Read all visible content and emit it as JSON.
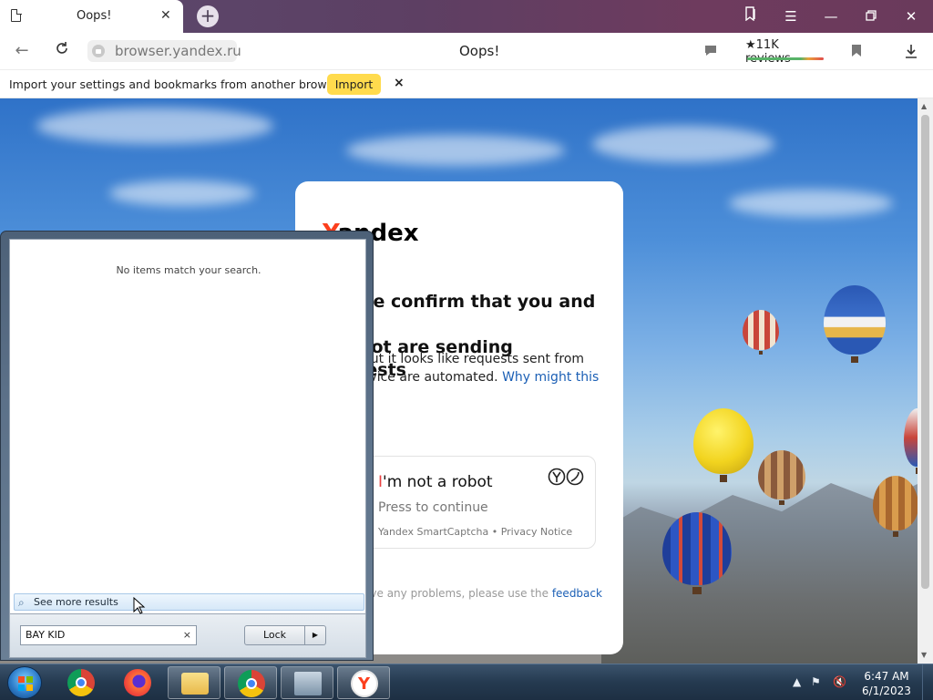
{
  "browser": {
    "tab_title": "Oops!",
    "url": "browser.yandex.ru",
    "page_title": "Oops!",
    "reviews_label": "★11K reviews"
  },
  "infobar": {
    "message": "Import your settings and bookmarks from another browser.",
    "import_label": "Import",
    "close_label": "×"
  },
  "captcha_page": {
    "logo_red": "Y",
    "logo_rest": "andex",
    "heading_line1": "Please confirm that you and not",
    "heading_line2": "a robot are sending requests",
    "para_text": "Sorry, but it looks like requests sent from your device are automated.",
    "para_link": "Why might this",
    "checkbox_mark": "I",
    "checkbox_label": "'m not a robot",
    "checkbox_sub": "Press to continue",
    "footer_text": "Yandex SmartCaptcha • Privacy Notice",
    "problem_text": "If you have any problems, please use the",
    "problem_link": "feedback"
  },
  "start_menu": {
    "no_items": "No items match your search.",
    "see_more": "See more results",
    "search_value": "BAY KID",
    "clear_label": "×",
    "lock_label": "Lock",
    "lock_arrow": "▶"
  },
  "taskbar": {
    "time": "6:47 AM",
    "date": "6/1/2023"
  },
  "colors": {
    "yandex_red": "#fc3f1d",
    "import_yellow": "#ffdb4d",
    "link_blue": "#1b5fb5"
  }
}
